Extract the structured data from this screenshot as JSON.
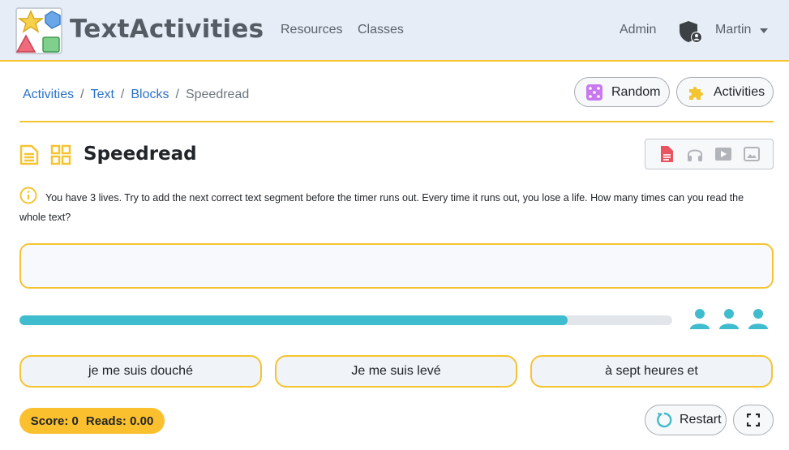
{
  "navbar": {
    "brand": "TextActivities",
    "links": [
      "Resources",
      "Classes"
    ],
    "admin": "Admin",
    "user": "Martin"
  },
  "breadcrumb": {
    "items": [
      "Activities",
      "Text",
      "Blocks"
    ],
    "current": "Speedread"
  },
  "header_buttons": {
    "random": "Random",
    "activities": "Activities"
  },
  "activity": {
    "title": "Speedread",
    "instructions": "You have 3 lives. Try to add the next correct text segment before the timer runs out. Every time it runs out, you lose a life. How many times can you read the whole text?",
    "answer_text": "",
    "progress": 0.84,
    "lives": 3,
    "options": [
      "je me suis douché",
      "Je me suis levé",
      "à sept heures et"
    ],
    "score_label": "Score: 0",
    "reads_label": "Reads: 0.00",
    "restart": "Restart"
  },
  "media_icons": [
    "document-icon",
    "headphones-icon",
    "video-icon",
    "image-icon"
  ],
  "colors": {
    "accent": "#f5c431",
    "progress": "#3fbccd",
    "link": "#2a72c6",
    "score_bg": "#fbc02d"
  }
}
